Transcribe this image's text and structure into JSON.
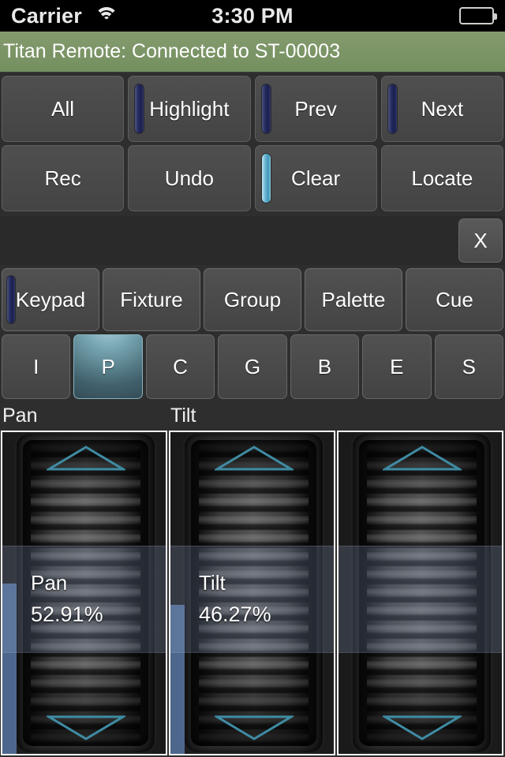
{
  "status_bar": {
    "carrier": "Carrier",
    "wifi_icon": "wifi-icon",
    "time": "3:30 PM",
    "battery_icon": "battery-full-icon"
  },
  "banner": {
    "text": "Titan Remote: Connected to ST-00003",
    "color": "#7a9464"
  },
  "command_buttons": {
    "row1": [
      {
        "label": "All",
        "led": null
      },
      {
        "label": "Highlight",
        "led": "off"
      },
      {
        "label": "Prev",
        "led": "off"
      },
      {
        "label": "Next",
        "led": "off"
      }
    ],
    "row2": [
      {
        "label": "Rec",
        "led": null
      },
      {
        "label": "Undo",
        "led": null
      },
      {
        "label": "Clear",
        "led": "on"
      },
      {
        "label": "Locate",
        "led": null
      }
    ]
  },
  "command_line": {
    "text": "",
    "clear_label": "X"
  },
  "mode_buttons": [
    {
      "label": "Keypad",
      "led": "off"
    },
    {
      "label": "Fixture",
      "led": null
    },
    {
      "label": "Group",
      "led": null
    },
    {
      "label": "Palette",
      "led": null
    },
    {
      "label": "Cue",
      "led": null
    }
  ],
  "attribute_buttons": [
    {
      "label": "I",
      "selected": false
    },
    {
      "label": "P",
      "selected": true
    },
    {
      "label": "C",
      "selected": false
    },
    {
      "label": "G",
      "selected": false
    },
    {
      "label": "B",
      "selected": false
    },
    {
      "label": "E",
      "selected": false
    },
    {
      "label": "S",
      "selected": false
    }
  ],
  "selected_attribute": "P",
  "faders": [
    {
      "title": "Pan",
      "name": "Pan",
      "value": "52.91%",
      "level_pct": 52.91,
      "has_level": true
    },
    {
      "title": "Tilt",
      "name": "Tilt",
      "value": "46.27%",
      "level_pct": 46.27,
      "has_level": true
    },
    {
      "title": "",
      "name": "",
      "value": "",
      "level_pct": 0,
      "has_level": false
    }
  ],
  "colors": {
    "led_off": "#252c5e",
    "led_on": "#6fb9d4",
    "selected_teal": "#7ba9b6",
    "arrow_teal": "#3f8ba3",
    "level_blue": "#5675a0",
    "band_blue": "rgba(150,170,210,0.22)"
  }
}
